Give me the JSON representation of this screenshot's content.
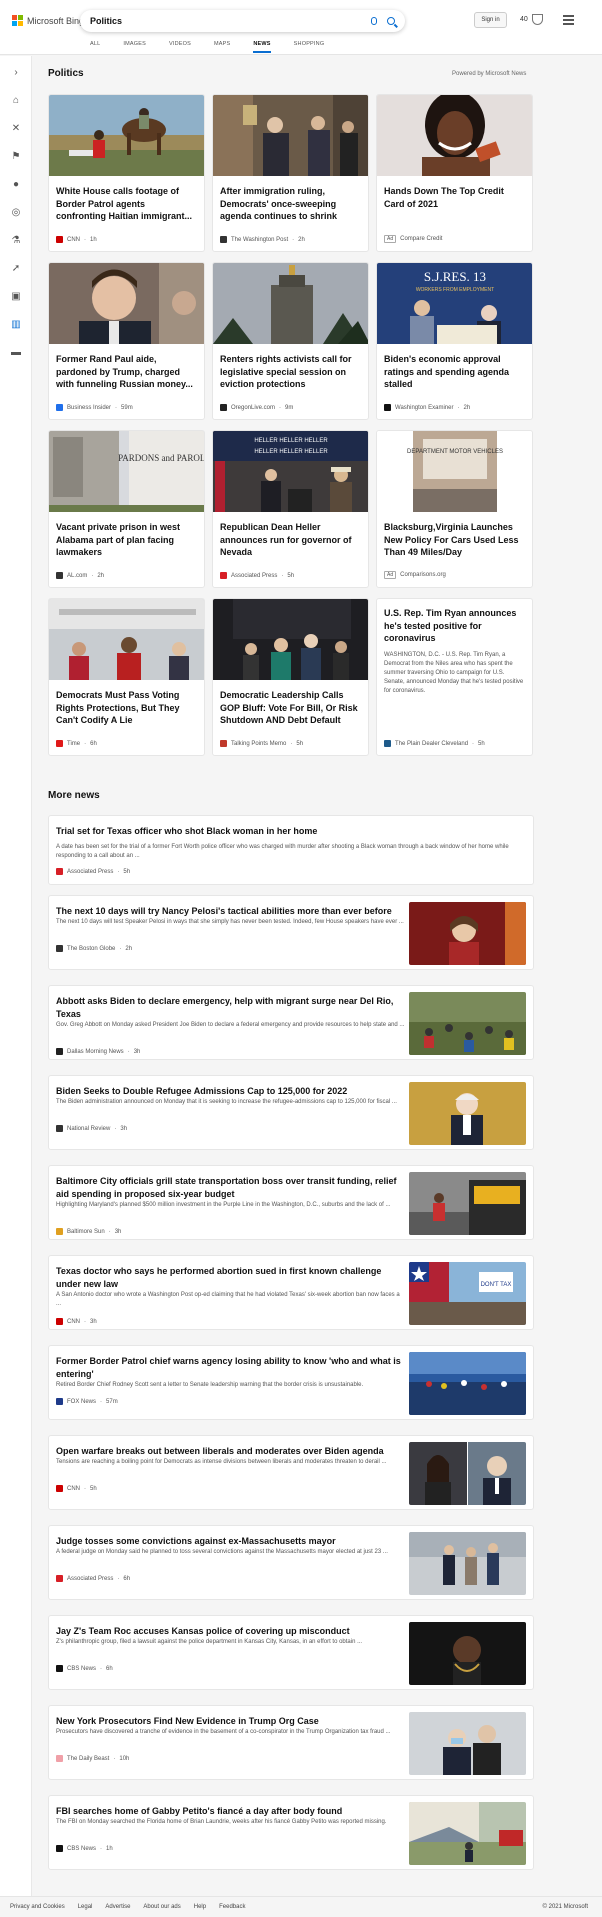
{
  "header": {
    "logo_text": "Microsoft Bing",
    "search_value": "Politics",
    "signin_label": "Sign in",
    "rewards_count": "40"
  },
  "tabs": [
    "ALL",
    "IMAGES",
    "VIDEOS",
    "MAPS",
    "NEWS",
    "SHOPPING"
  ],
  "active_tab": "NEWS",
  "section": {
    "title": "Politics",
    "powered": "Powered by Microsoft News"
  },
  "cards": [
    {
      "title": "White House calls footage of Border Patrol agents confronting Haitian immigrant...",
      "source": "CNN",
      "time": "1h"
    },
    {
      "title": "After immigration ruling, Democrats' once-sweeping agenda continues to shrink",
      "source": "The Washington Post",
      "time": "2h"
    },
    {
      "title": "Hands Down The Top Credit Card of 2021",
      "source": "Compare Credit",
      "ad": "Ad"
    },
    {
      "title": "Former Rand Paul aide, pardoned by Trump, charged with funneling Russian money...",
      "source": "Business Insider",
      "time": "59m"
    },
    {
      "title": "Renters rights activists call for legislative special session on eviction protections",
      "source": "OregonLive.com",
      "time": "9m"
    },
    {
      "title": "Biden's economic approval ratings and spending agenda stalled",
      "source": "Washington Examiner",
      "time": "2h"
    },
    {
      "title": "Vacant private prison in west Alabama part of plan facing lawmakers",
      "source": "AL.com",
      "time": "2h"
    },
    {
      "title": "Republican Dean Heller announces run for governor of Nevada",
      "source": "Associated Press",
      "time": "5h"
    },
    {
      "title": "Blacksburg,Virginia Launches New Policy For Cars Used Less Than 49 Miles/Day",
      "source": "Comparisons.org",
      "ad": "Ad"
    },
    {
      "title": "Democrats Must Pass Voting Rights Protections, But They Can't Codify A Lie",
      "source": "Time",
      "time": "6h"
    },
    {
      "title": "Democratic Leadership Calls GOP Bluff: Vote For Bill, Or Risk Shutdown AND Debt Default",
      "source": "Talking Points Memo",
      "time": "5h"
    },
    {
      "title": "U.S. Rep. Tim Ryan announces he's tested positive for coronavirus",
      "snippet": "WASHINGTON, D.C. - U.S. Rep. Tim Ryan, a Democrat from the Niles area who has spent the summer traversing Ohio to campaign for U.S. Senate, announced Monday that he's tested positive for coronavirus.",
      "source": "The Plain Dealer Cleveland",
      "time": "5h"
    }
  ],
  "sign_texts": {
    "pardons": "PARDONS and PAROLES",
    "sjres": "S.J.RES. 13",
    "sjres_sub": "WORKERS FROM EMPLOYMENT",
    "heller": "HELLER HELLER HELLER",
    "dmv": "DEPARTMENT MOTOR VEHICLES",
    "protest": "DON'T TAX"
  },
  "more_news_title": "More news",
  "more_news": [
    {
      "title": "Trial set for Texas officer who shot Black woman in her home",
      "snippet": "A date has been set for the trial of a former Fort Worth police officer who was charged with murder after shooting a Black woman through a back window of her home while responding to a call about an ...",
      "source": "Associated Press",
      "time": "5h"
    },
    {
      "title": "The next 10 days will try Nancy Pelosi's tactical abilities more than ever before",
      "snippet": "The next 10 days will test Speaker Pelosi in ways that she simply has never been tested. Indeed, few House speakers have ever ...",
      "source": "The Boston Globe",
      "time": "2h"
    },
    {
      "title": "Abbott asks Biden to declare emergency, help with migrant surge near Del Rio, Texas",
      "snippet": "Gov. Greg Abbott on Monday asked President Joe Biden to declare a federal emergency and provide resources to help state and ...",
      "source": "Dallas Morning News",
      "time": "3h"
    },
    {
      "title": "Biden Seeks to Double Refugee Admissions Cap to 125,000 for 2022",
      "snippet": "The Biden administration announced on Monday that it is seeking to increase the refugee-admissions cap to 125,000 for fiscal ...",
      "source": "National Review",
      "time": "3h"
    },
    {
      "title": "Baltimore City officials grill state transportation boss over transit funding, relief aid spending in proposed six-year budget",
      "snippet": "Highlighting Maryland's planned $500 million investment in the Purple Line in the Washington, D.C., suburbs and the lack of ...",
      "source": "Baltimore Sun",
      "time": "3h"
    },
    {
      "title": "Texas doctor who says he performed abortion sued in first known challenge under new law",
      "snippet": "A San Antonio doctor who wrote a Washington Post op-ed claiming that he had violated Texas' six-week abortion ban now faces a ...",
      "source": "CNN",
      "time": "3h"
    },
    {
      "title": "Former Border Patrol chief warns agency losing ability to know 'who and what is entering'",
      "snippet": "Retired Border Chief Rodney Scott sent a letter to Senate leadership warning that the border crisis is unsustainable.",
      "source": "FOX News",
      "time": "57m"
    },
    {
      "title": "Open warfare breaks out between liberals and moderates over Biden agenda",
      "snippet": "Tensions are reaching a boiling point for Democrats as intense divisions between liberals and moderates threaten to derail ...",
      "source": "CNN",
      "time": "5h"
    },
    {
      "title": "Judge tosses some convictions against ex-Massachusetts mayor",
      "snippet": "A federal judge on Monday said he planned to toss several convictions against the Massachusetts mayor elected at just 23 ...",
      "source": "Associated Press",
      "time": "6h"
    },
    {
      "title": "Jay Z's Team Roc accuses Kansas police of covering up misconduct",
      "snippet": "Z's philanthropic group, filed a lawsuit against the police department in Kansas City, Kansas, in an effort to obtain ...",
      "source": "CBS News",
      "time": "6h"
    },
    {
      "title": "New York Prosecutors Find New Evidence in Trump Org Case",
      "snippet": "Prosecutors have discovered a tranche of evidence in the basement of a co-conspirator in the Trump Organization tax fraud ...",
      "source": "The Daily Beast",
      "time": "10h"
    },
    {
      "title": "FBI searches home of Gabby Petito's fiancé a day after body found",
      "snippet": "The FBI on Monday searched the Florida home of Brian Laundrie, weeks after his fiancé Gabby Petito was reported missing.",
      "source": "CBS News",
      "time": "1h"
    }
  ],
  "footer": {
    "links": [
      "Privacy and Cookies",
      "Legal",
      "Advertise",
      "About our ads",
      "Help",
      "Feedback"
    ],
    "copyright": "© 2021 Microsoft"
  },
  "colors": {
    "accent": "#0a6ed1",
    "cnn": "#cc0000",
    "ap": "#d71f26"
  }
}
